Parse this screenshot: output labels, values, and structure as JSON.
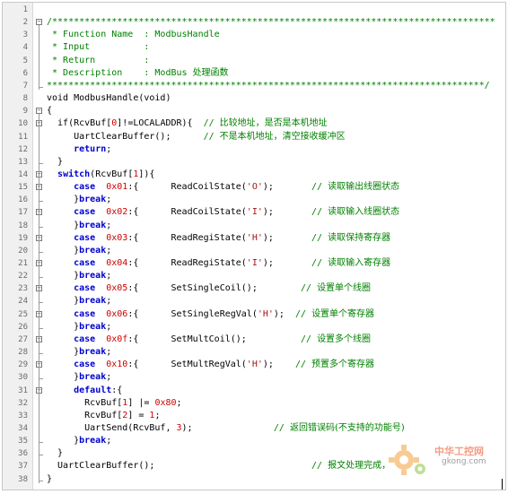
{
  "code_lines": [
    {
      "num": "1",
      "parts": []
    },
    {
      "num": "2",
      "parts": [
        {
          "t": "/**********************************************************************************",
          "c": "cm"
        }
      ]
    },
    {
      "num": "3",
      "parts": [
        {
          "t": " * Function Name  : ModbusHandle",
          "c": "cm"
        }
      ]
    },
    {
      "num": "4",
      "parts": [
        {
          "t": " * Input          :",
          "c": "cm"
        }
      ]
    },
    {
      "num": "5",
      "parts": [
        {
          "t": " * Return         :",
          "c": "cm"
        }
      ]
    },
    {
      "num": "6",
      "parts": [
        {
          "t": " * Description    : ModBus ",
          "c": "cm"
        },
        {
          "t": "处理函数",
          "c": "cm cn"
        }
      ]
    },
    {
      "num": "7",
      "parts": [
        {
          "t": "*********************************************************************************/",
          "c": "cm"
        }
      ]
    },
    {
      "num": "8",
      "parts": [
        {
          "t": "void ModbusHandle(void)",
          "c": ""
        }
      ]
    },
    {
      "num": "9",
      "parts": [
        {
          "t": "{",
          "c": ""
        }
      ]
    },
    {
      "num": "10",
      "parts": [
        {
          "t": "  if(RcvBuf[",
          "c": ""
        },
        {
          "t": "0",
          "c": "nm"
        },
        {
          "t": "]!=LOCALADDR){  ",
          "c": ""
        },
        {
          "t": "// ",
          "c": "cm"
        },
        {
          "t": "比较地址，是否是本机地址",
          "c": "cm cn"
        }
      ]
    },
    {
      "num": "11",
      "parts": [
        {
          "t": "     UartClearBuffer();      ",
          "c": ""
        },
        {
          "t": "// ",
          "c": "cm"
        },
        {
          "t": "不是本机地址，清空接收缓冲区",
          "c": "cm cn"
        }
      ]
    },
    {
      "num": "12",
      "parts": [
        {
          "t": "     ",
          "c": ""
        },
        {
          "t": "return",
          "c": "kw"
        },
        {
          "t": ";",
          "c": ""
        }
      ]
    },
    {
      "num": "13",
      "parts": [
        {
          "t": "  }",
          "c": ""
        }
      ]
    },
    {
      "num": "14",
      "parts": [
        {
          "t": "  ",
          "c": ""
        },
        {
          "t": "switch",
          "c": "kw"
        },
        {
          "t": "(RcvBuf[",
          "c": ""
        },
        {
          "t": "1",
          "c": "nm"
        },
        {
          "t": "]){",
          "c": ""
        }
      ]
    },
    {
      "num": "15",
      "parts": [
        {
          "t": "     ",
          "c": ""
        },
        {
          "t": "case",
          "c": "kw"
        },
        {
          "t": "  ",
          "c": ""
        },
        {
          "t": "0x01",
          "c": "nm"
        },
        {
          "t": ":{      ReadCoilState(",
          "c": ""
        },
        {
          "t": "'O'",
          "c": "st"
        },
        {
          "t": ");       ",
          "c": ""
        },
        {
          "t": "// ",
          "c": "cm"
        },
        {
          "t": "读取输出线圈状态",
          "c": "cm cn"
        }
      ]
    },
    {
      "num": "16",
      "parts": [
        {
          "t": "     }",
          "c": ""
        },
        {
          "t": "break",
          "c": "kw"
        },
        {
          "t": ";",
          "c": ""
        }
      ]
    },
    {
      "num": "17",
      "parts": [
        {
          "t": "     ",
          "c": ""
        },
        {
          "t": "case",
          "c": "kw"
        },
        {
          "t": "  ",
          "c": ""
        },
        {
          "t": "0x02",
          "c": "nm"
        },
        {
          "t": ":{      ReadCoilState(",
          "c": ""
        },
        {
          "t": "'I'",
          "c": "st"
        },
        {
          "t": ");       ",
          "c": ""
        },
        {
          "t": "// ",
          "c": "cm"
        },
        {
          "t": "读取输入线圈状态",
          "c": "cm cn"
        }
      ]
    },
    {
      "num": "18",
      "parts": [
        {
          "t": "     }",
          "c": ""
        },
        {
          "t": "break",
          "c": "kw"
        },
        {
          "t": ";",
          "c": ""
        }
      ]
    },
    {
      "num": "19",
      "parts": [
        {
          "t": "     ",
          "c": ""
        },
        {
          "t": "case",
          "c": "kw"
        },
        {
          "t": "  ",
          "c": ""
        },
        {
          "t": "0x03",
          "c": "nm"
        },
        {
          "t": ":{      ReadRegiState(",
          "c": ""
        },
        {
          "t": "'H'",
          "c": "st"
        },
        {
          "t": ");       ",
          "c": ""
        },
        {
          "t": "// ",
          "c": "cm"
        },
        {
          "t": "读取保持寄存器",
          "c": "cm cn"
        }
      ]
    },
    {
      "num": "20",
      "parts": [
        {
          "t": "     }",
          "c": ""
        },
        {
          "t": "break",
          "c": "kw"
        },
        {
          "t": ";",
          "c": ""
        }
      ]
    },
    {
      "num": "21",
      "parts": [
        {
          "t": "     ",
          "c": ""
        },
        {
          "t": "case",
          "c": "kw"
        },
        {
          "t": "  ",
          "c": ""
        },
        {
          "t": "0x04",
          "c": "nm"
        },
        {
          "t": ":{      ReadRegiState(",
          "c": ""
        },
        {
          "t": "'I'",
          "c": "st"
        },
        {
          "t": ");       ",
          "c": ""
        },
        {
          "t": "// ",
          "c": "cm"
        },
        {
          "t": "读取输入寄存器",
          "c": "cm cn"
        }
      ]
    },
    {
      "num": "22",
      "parts": [
        {
          "t": "     }",
          "c": ""
        },
        {
          "t": "break",
          "c": "kw"
        },
        {
          "t": ";",
          "c": ""
        }
      ]
    },
    {
      "num": "23",
      "parts": [
        {
          "t": "     ",
          "c": ""
        },
        {
          "t": "case",
          "c": "kw"
        },
        {
          "t": "  ",
          "c": ""
        },
        {
          "t": "0x05",
          "c": "nm"
        },
        {
          "t": ":{      SetSingleCoil();        ",
          "c": ""
        },
        {
          "t": "// ",
          "c": "cm"
        },
        {
          "t": "设置单个线圈",
          "c": "cm cn"
        }
      ]
    },
    {
      "num": "24",
      "parts": [
        {
          "t": "     }",
          "c": ""
        },
        {
          "t": "break",
          "c": "kw"
        },
        {
          "t": ";",
          "c": ""
        }
      ]
    },
    {
      "num": "25",
      "parts": [
        {
          "t": "     ",
          "c": ""
        },
        {
          "t": "case",
          "c": "kw"
        },
        {
          "t": "  ",
          "c": ""
        },
        {
          "t": "0x06",
          "c": "nm"
        },
        {
          "t": ":{      SetSingleRegVal(",
          "c": ""
        },
        {
          "t": "'H'",
          "c": "st"
        },
        {
          "t": ");  ",
          "c": ""
        },
        {
          "t": "// ",
          "c": "cm"
        },
        {
          "t": "设置单个寄存器",
          "c": "cm cn"
        }
      ]
    },
    {
      "num": "26",
      "parts": [
        {
          "t": "     }",
          "c": ""
        },
        {
          "t": "break",
          "c": "kw"
        },
        {
          "t": ";",
          "c": ""
        }
      ]
    },
    {
      "num": "27",
      "parts": [
        {
          "t": "     ",
          "c": ""
        },
        {
          "t": "case",
          "c": "kw"
        },
        {
          "t": "  ",
          "c": ""
        },
        {
          "t": "0x0f",
          "c": "nm"
        },
        {
          "t": ":{      SetMultCoil();          ",
          "c": ""
        },
        {
          "t": "// ",
          "c": "cm"
        },
        {
          "t": "设置多个线圈",
          "c": "cm cn"
        }
      ]
    },
    {
      "num": "28",
      "parts": [
        {
          "t": "     }",
          "c": ""
        },
        {
          "t": "break",
          "c": "kw"
        },
        {
          "t": ";",
          "c": ""
        }
      ]
    },
    {
      "num": "29",
      "parts": [
        {
          "t": "     ",
          "c": ""
        },
        {
          "t": "case",
          "c": "kw"
        },
        {
          "t": "  ",
          "c": ""
        },
        {
          "t": "0x10",
          "c": "nm"
        },
        {
          "t": ":{      SetMultRegVal(",
          "c": ""
        },
        {
          "t": "'H'",
          "c": "st"
        },
        {
          "t": ");    ",
          "c": ""
        },
        {
          "t": "// ",
          "c": "cm"
        },
        {
          "t": "预置多个寄存器",
          "c": "cm cn"
        }
      ]
    },
    {
      "num": "30",
      "parts": [
        {
          "t": "     }",
          "c": ""
        },
        {
          "t": "break",
          "c": "kw"
        },
        {
          "t": ";",
          "c": ""
        }
      ]
    },
    {
      "num": "31",
      "parts": [
        {
          "t": "     ",
          "c": ""
        },
        {
          "t": "default",
          "c": "kw"
        },
        {
          "t": ":{",
          "c": ""
        }
      ]
    },
    {
      "num": "32",
      "parts": [
        {
          "t": "       RcvBuf[",
          "c": ""
        },
        {
          "t": "1",
          "c": "nm"
        },
        {
          "t": "] |= ",
          "c": ""
        },
        {
          "t": "0x80",
          "c": "nm"
        },
        {
          "t": ";",
          "c": ""
        }
      ]
    },
    {
      "num": "33",
      "parts": [
        {
          "t": "       RcvBuf[",
          "c": ""
        },
        {
          "t": "2",
          "c": "nm"
        },
        {
          "t": "] = ",
          "c": ""
        },
        {
          "t": "1",
          "c": "nm"
        },
        {
          "t": ";",
          "c": ""
        }
      ]
    },
    {
      "num": "34",
      "parts": [
        {
          "t": "       UartSend(RcvBuf, ",
          "c": ""
        },
        {
          "t": "3",
          "c": "nm"
        },
        {
          "t": ");               ",
          "c": ""
        },
        {
          "t": "// ",
          "c": "cm"
        },
        {
          "t": "返回错误码(不支持的功能号)",
          "c": "cm cn"
        }
      ]
    },
    {
      "num": "35",
      "parts": [
        {
          "t": "     }",
          "c": ""
        },
        {
          "t": "break",
          "c": "kw"
        },
        {
          "t": ";",
          "c": ""
        }
      ]
    },
    {
      "num": "36",
      "parts": [
        {
          "t": "  }",
          "c": ""
        }
      ]
    },
    {
      "num": "37",
      "parts": [
        {
          "t": "  UartClearBuffer();                             ",
          "c": ""
        },
        {
          "t": "// ",
          "c": "cm"
        },
        {
          "t": "报文处理完成，",
          "c": "cm cn"
        }
      ]
    },
    {
      "num": "38",
      "parts": [
        {
          "t": "}",
          "c": ""
        }
      ]
    }
  ],
  "fold_markers": [
    {
      "line": 2,
      "sym": "−"
    },
    {
      "line": 9,
      "sym": "−"
    },
    {
      "line": 10,
      "sym": "−"
    },
    {
      "line": 14,
      "sym": "−"
    },
    {
      "line": 15,
      "sym": "−"
    },
    {
      "line": 17,
      "sym": "−"
    },
    {
      "line": 19,
      "sym": "−"
    },
    {
      "line": 21,
      "sym": "−"
    },
    {
      "line": 23,
      "sym": "−"
    },
    {
      "line": 25,
      "sym": "−"
    },
    {
      "line": 27,
      "sym": "−"
    },
    {
      "line": 29,
      "sym": "−"
    },
    {
      "line": 31,
      "sym": "−"
    }
  ],
  "watermark": {
    "title": "中华工控网",
    "url": "gkong.com"
  },
  "colors": {
    "comment": "#008000",
    "keyword": "#0000d0",
    "number": "#d00000",
    "string": "#a31515"
  }
}
